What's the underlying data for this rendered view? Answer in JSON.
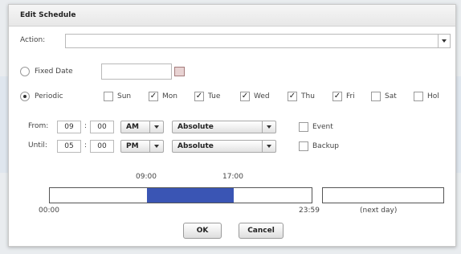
{
  "dialog": {
    "title": "Edit Schedule"
  },
  "action": {
    "label": "Action:",
    "value": ""
  },
  "fixed_date": {
    "label": "Fixed Date",
    "selected": false,
    "value": ""
  },
  "periodic": {
    "label": "Periodic",
    "selected": true
  },
  "days": [
    {
      "label": "Sun",
      "checked": false
    },
    {
      "label": "Mon",
      "checked": true
    },
    {
      "label": "Tue",
      "checked": true
    },
    {
      "label": "Wed",
      "checked": true
    },
    {
      "label": "Thu",
      "checked": true
    },
    {
      "label": "Fri",
      "checked": true
    },
    {
      "label": "Sat",
      "checked": false
    },
    {
      "label": "Hol",
      "checked": false
    }
  ],
  "from": {
    "label": "From:",
    "hour": "09",
    "minute": "00",
    "ampm": "AM",
    "mode": "Absolute"
  },
  "until": {
    "label": "Until:",
    "hour": "05",
    "minute": "00",
    "ampm": "PM",
    "mode": "Absolute"
  },
  "time_separator": ":",
  "options": {
    "event": {
      "label": "Event",
      "checked": false
    },
    "backup": {
      "label": "Backup",
      "checked": false
    }
  },
  "timeline": {
    "start_marker": "09:00",
    "end_marker": "17:00",
    "day_start": "00:00",
    "day_end": "23:59",
    "next_day": "(next day)",
    "fill_color": "#3a55b4"
  },
  "buttons": {
    "ok": "OK",
    "cancel": "Cancel"
  },
  "icons": {
    "calendar": "calendar-icon",
    "dropdown": "chevron-down-icon",
    "check": "✓"
  }
}
